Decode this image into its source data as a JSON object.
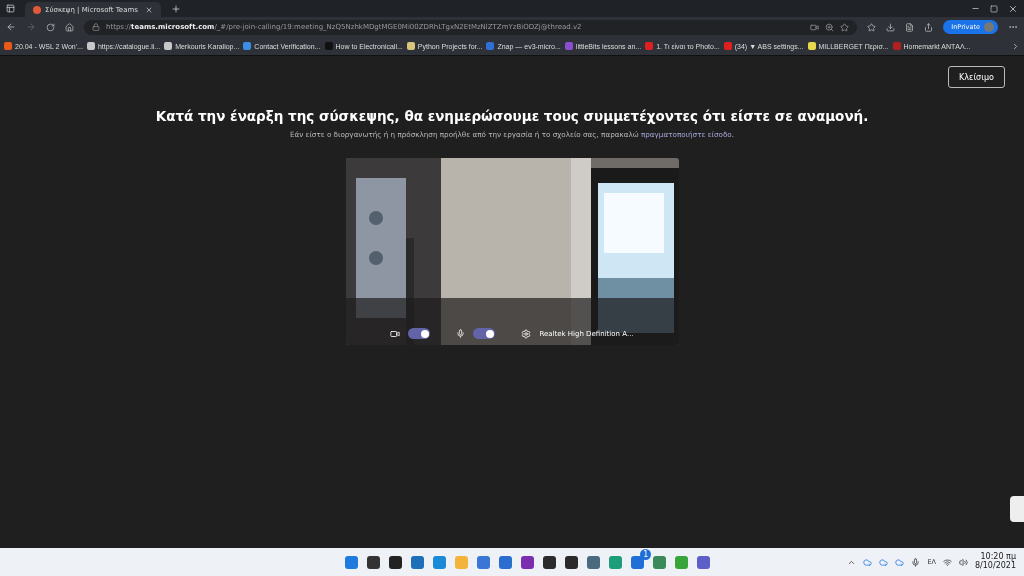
{
  "browser": {
    "tab": {
      "title": "Σύσκεψη | Microsoft Teams",
      "selected": true
    },
    "address": "https://**teams.microsoft.com**/_#/pre-join-calling/19:meeting_NzQ5NzhkMDgtMGE0Mi00ZDRhLTgxN2EtMzNlZTZmYzBiODZj@thread.v2",
    "inprivate": "InPrivate",
    "bookmarks": [
      {
        "label": "20.04 - WSL 2 Won'...",
        "color": "#e8591a"
      },
      {
        "label": "https://catalogue.li...",
        "color": "#c8c8c8"
      },
      {
        "label": "Merkouris Karaliop...",
        "color": "#c8c8c8"
      },
      {
        "label": "Contact Verification...",
        "color": "#3a8ee6"
      },
      {
        "label": "How to Electronicall...",
        "color": "#111111"
      },
      {
        "label": "Python Projects for...",
        "color": "#d8c47a"
      },
      {
        "label": "Znap — ev3-micro...",
        "color": "#2f6fd6"
      },
      {
        "label": "littleBits lessons an...",
        "color": "#8a4fd0"
      },
      {
        "label": "1. Τι είναι το Photo...",
        "color": "#e02020"
      },
      {
        "label": "(34) ▼ ABS settings...",
        "color": "#e02020"
      },
      {
        "label": "MILLBERGET Περισ...",
        "color": "#e6d84a"
      },
      {
        "label": "Homemarkt ANTΑΛ...",
        "color": "#b02020"
      }
    ]
  },
  "page": {
    "close_button": "Κλείσιμο",
    "heading": "Κατά την έναρξη της σύσκεψης, θα ενημερώσουμε τους συμμετέχοντες ότι είστε σε αναμονή.",
    "subtitle": "Εάν είστε ο διοργανωτής ή η πρόσκληση προήλθε από την εργασία ή το σχολείο σας, παρακαλώ",
    "sign_in_link": "πραγματοποιήστε είσοδο",
    "subtitle_end": ".",
    "preview": {
      "kind": "picture",
      "camera": {
        "on": true
      },
      "microphone": {
        "on": true
      },
      "device": "Realtek High Definition A..."
    }
  },
  "taskbar": {
    "apps": [
      {
        "color": "#1f7ae0"
      },
      {
        "color": "#333333"
      },
      {
        "color": "#222222"
      },
      {
        "color": "#1c6fb8"
      },
      {
        "color": "#1a8ad8"
      },
      {
        "color": "#f2b43a"
      },
      {
        "color": "#3a76d6"
      },
      {
        "color": "#2a6fd0"
      },
      {
        "color": "#7b2fb0"
      },
      {
        "color": "#2b2b2b"
      },
      {
        "color": "#2b2b2b"
      },
      {
        "color": "#4a6a80"
      },
      {
        "color": "#1c9e7a"
      },
      {
        "color": "#1f6fd8"
      },
      {
        "color": "#3c8a5a"
      },
      {
        "color": "#37a53a"
      },
      {
        "color": "#5b5fc7"
      }
    ],
    "badge": "1",
    "language": "ΕΛ",
    "time": "10:20 πμ",
    "date": "8/10/2021"
  }
}
